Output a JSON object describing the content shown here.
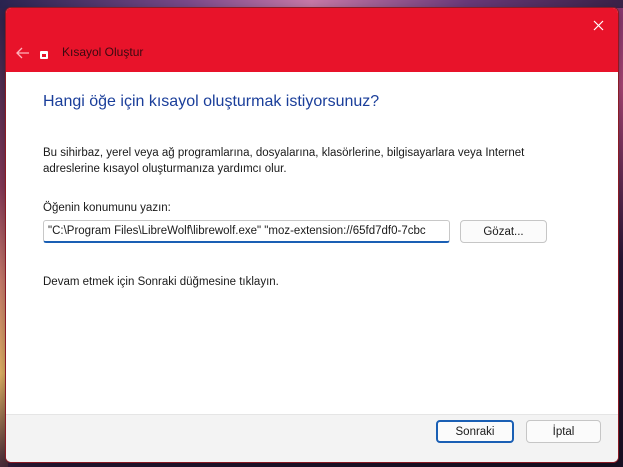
{
  "window": {
    "title": "Kısayol Oluştur",
    "titlebar_color": "#e8132a"
  },
  "page": {
    "heading": "Hangi öğe için kısayol oluşturmak istiyorsunuz?",
    "description": "Bu sihirbaz, yerel veya ağ programlarına, dosyalarına, klasörlerine, bilgisayarlara veya Internet adreslerine kısayol oluşturmanıza yardımcı olur.",
    "location_label": "Öğenin konumunu yazın:",
    "location_value": "\"C:\\Program Files\\LibreWolf\\librewolf.exe\" \"moz-extension://65fd7df0-7cbc",
    "browse_label": "Gözat...",
    "hint": "Devam etmek için Sonraki düğmesine tıklayın."
  },
  "footer": {
    "next_label": "Sonraki",
    "cancel_label": "İptal"
  },
  "icons": {
    "back": "back-arrow-icon",
    "close": "close-icon",
    "app": "shortcut-app-icon"
  }
}
